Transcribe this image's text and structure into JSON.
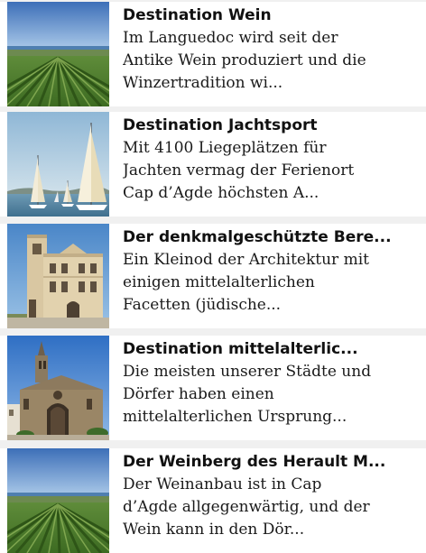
{
  "list": {
    "items": [
      {
        "title": "Destination Wein",
        "desc_lines": [
          "Im Languedoc wird seit der",
          "Antike Wein produziert und die",
          "Winzertradition wi..."
        ],
        "image": "vineyard-image"
      },
      {
        "title": "Destination Jachtsport",
        "desc_lines": [
          "Mit 4100 Liegeplätzen für",
          "Jachten vermag der Ferienort",
          "Cap d’Agde höchsten A..."
        ],
        "image": "sailboats-image"
      },
      {
        "title": "Der denkmalgeschützte Bere...",
        "desc_lines": [
          "Ein Kleinod der Architektur mit",
          "einigen mittelalterlichen",
          "Facetten (jüdische..."
        ],
        "image": "historic-building-image"
      },
      {
        "title": "Destination mittelalterlic...",
        "desc_lines": [
          "Die meisten unserer Städte und",
          "Dörfer haben einen",
          "mittelalterlichen Ursprung..."
        ],
        "image": "church-image"
      },
      {
        "title": "Der Weinberg des Herault M...",
        "desc_lines": [
          "Der Weinanbau ist in Cap",
          "d’Agde allgegenwärtig, und der",
          "Wein kann in den Dör..."
        ],
        "image": "vineyard-image"
      }
    ]
  }
}
